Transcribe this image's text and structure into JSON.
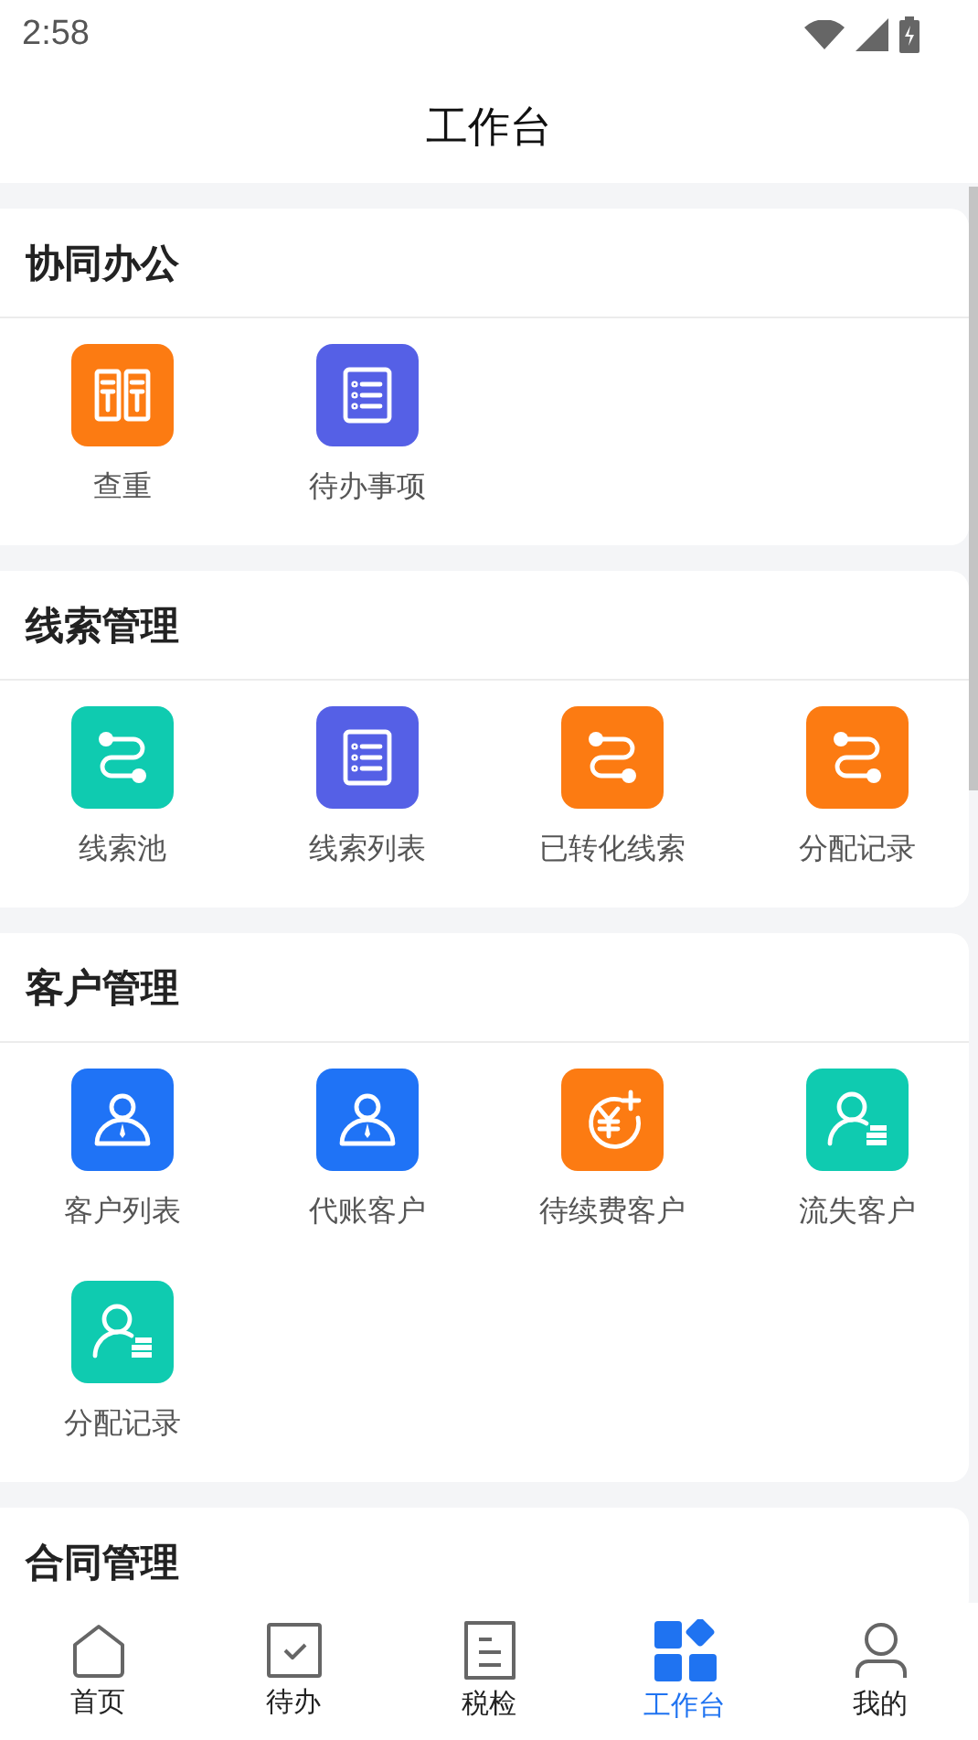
{
  "status_bar": {
    "time": "2:58"
  },
  "header": {
    "title": "工作台"
  },
  "sections": [
    {
      "title": "协同办公",
      "items": [
        {
          "label": "查重",
          "kind": "books",
          "color": "#fc7b12"
        },
        {
          "label": "待办事项",
          "kind": "list",
          "color": "#5560e6"
        }
      ]
    },
    {
      "title": "线索管理",
      "items": [
        {
          "label": "线索池",
          "kind": "route",
          "color": "#0fcbb0"
        },
        {
          "label": "线索列表",
          "kind": "list",
          "color": "#5560e6"
        },
        {
          "label": "已转化线索",
          "kind": "route",
          "color": "#fc7b12"
        },
        {
          "label": "分配记录",
          "kind": "route",
          "color": "#fc7b12"
        }
      ]
    },
    {
      "title": "客户管理",
      "items": [
        {
          "label": "客户列表",
          "kind": "person",
          "color": "#1f73f6"
        },
        {
          "label": "代账客户",
          "kind": "person",
          "color": "#1f73f6"
        },
        {
          "label": "待续费客户",
          "kind": "yen",
          "color": "#fc7b12"
        },
        {
          "label": "流失客户",
          "kind": "coins",
          "color": "#0fcbb0"
        },
        {
          "label": "分配记录",
          "kind": "coins",
          "color": "#0fcbb0"
        }
      ]
    },
    {
      "title": "合同管理"
    }
  ],
  "tabs": [
    {
      "label": "首页",
      "kind": "house",
      "selected": false
    },
    {
      "label": "待办",
      "kind": "check",
      "selected": false
    },
    {
      "label": "税检",
      "kind": "doc",
      "selected": false
    },
    {
      "label": "工作台",
      "kind": "grid",
      "selected": true
    },
    {
      "label": "我的",
      "kind": "person",
      "selected": false
    }
  ]
}
